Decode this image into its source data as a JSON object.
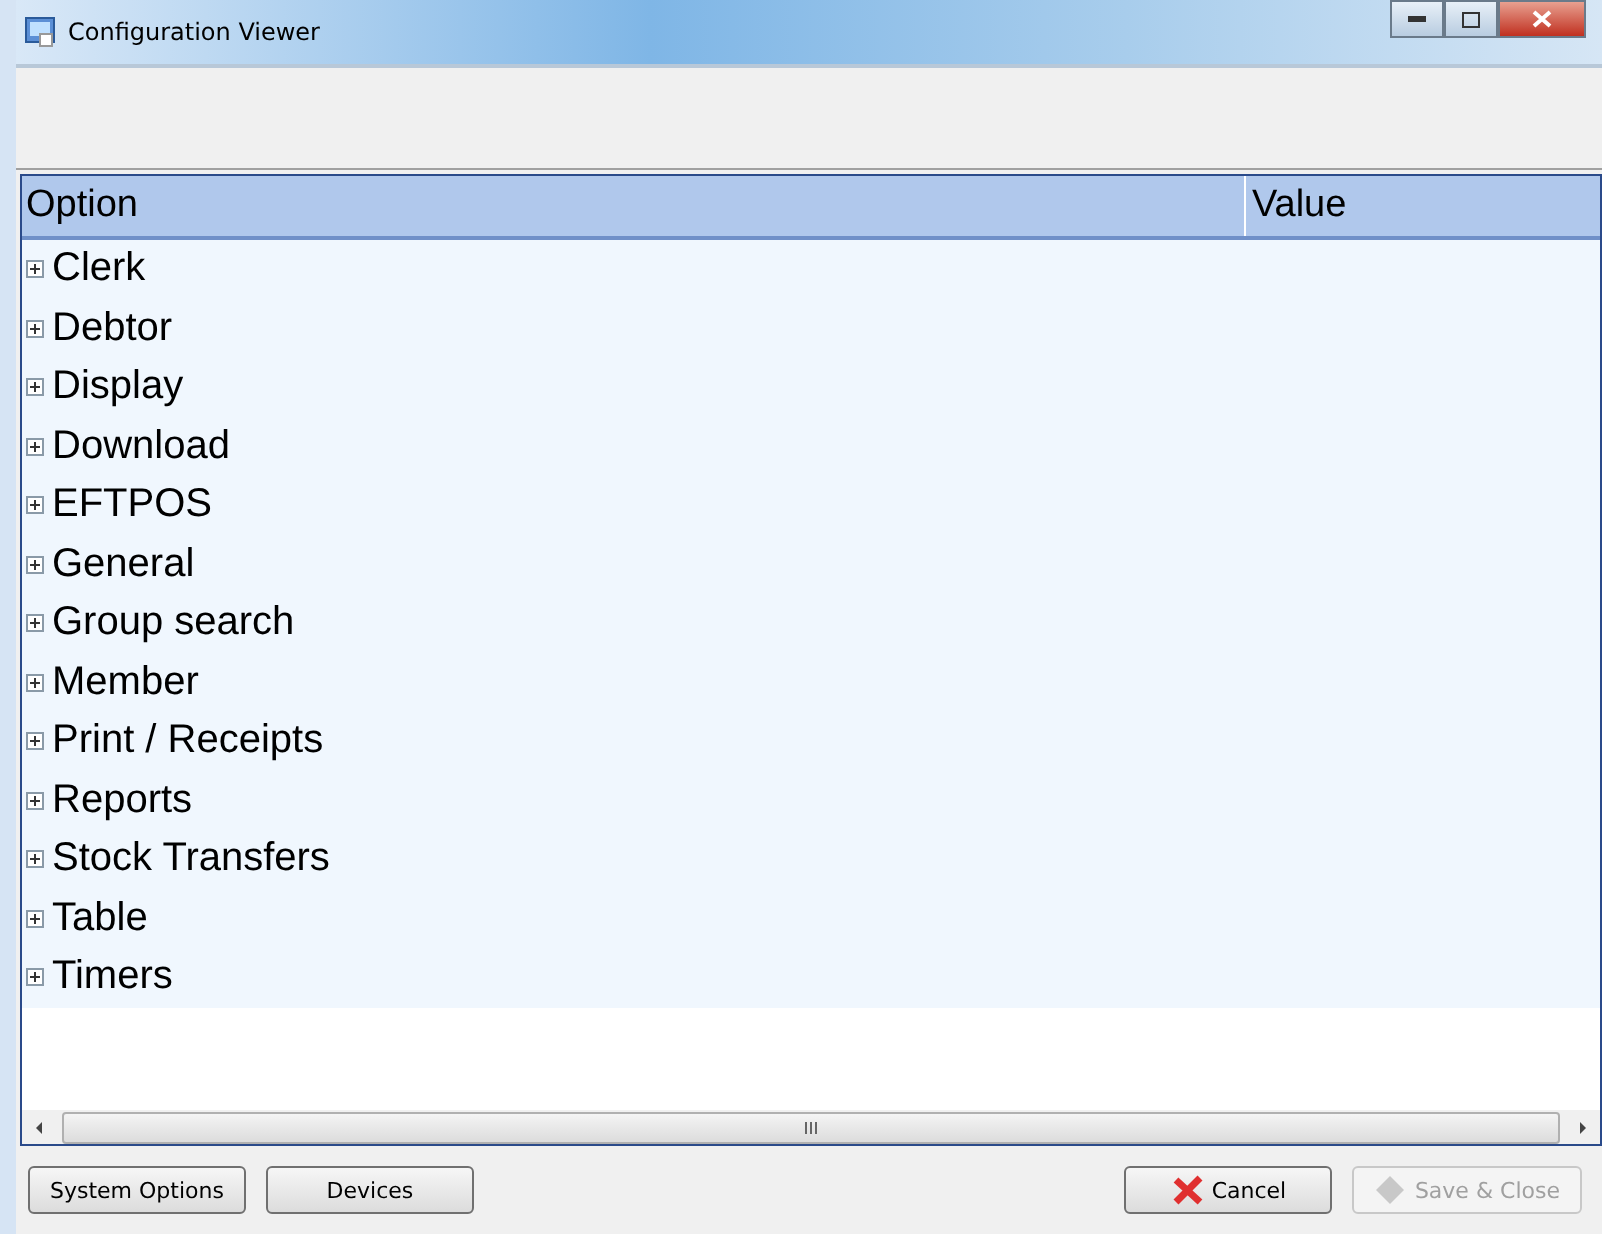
{
  "window": {
    "title": "Configuration Viewer"
  },
  "table": {
    "columns": [
      "Option",
      "Value"
    ],
    "rows": [
      {
        "label": "Clerk",
        "expanded": false
      },
      {
        "label": "Debtor",
        "expanded": false
      },
      {
        "label": "Display",
        "expanded": false
      },
      {
        "label": "Download",
        "expanded": false
      },
      {
        "label": "EFTPOS",
        "expanded": false
      },
      {
        "label": "General",
        "expanded": false
      },
      {
        "label": "Group search",
        "expanded": false
      },
      {
        "label": "Member",
        "expanded": false
      },
      {
        "label": "Print / Receipts",
        "expanded": false
      },
      {
        "label": "Reports",
        "expanded": false
      },
      {
        "label": "Stock Transfers",
        "expanded": false
      },
      {
        "label": "Table",
        "expanded": false
      },
      {
        "label": "Timers",
        "expanded": false
      }
    ]
  },
  "buttons": [
    {
      "label": "System Options",
      "kind": "plain",
      "disabled": false
    },
    {
      "label": "Devices",
      "kind": "plain",
      "disabled": false
    },
    {
      "label": "Cancel",
      "kind": "cancel",
      "disabled": false
    },
    {
      "label": "Save & Close",
      "kind": "save",
      "disabled": true
    }
  ]
}
